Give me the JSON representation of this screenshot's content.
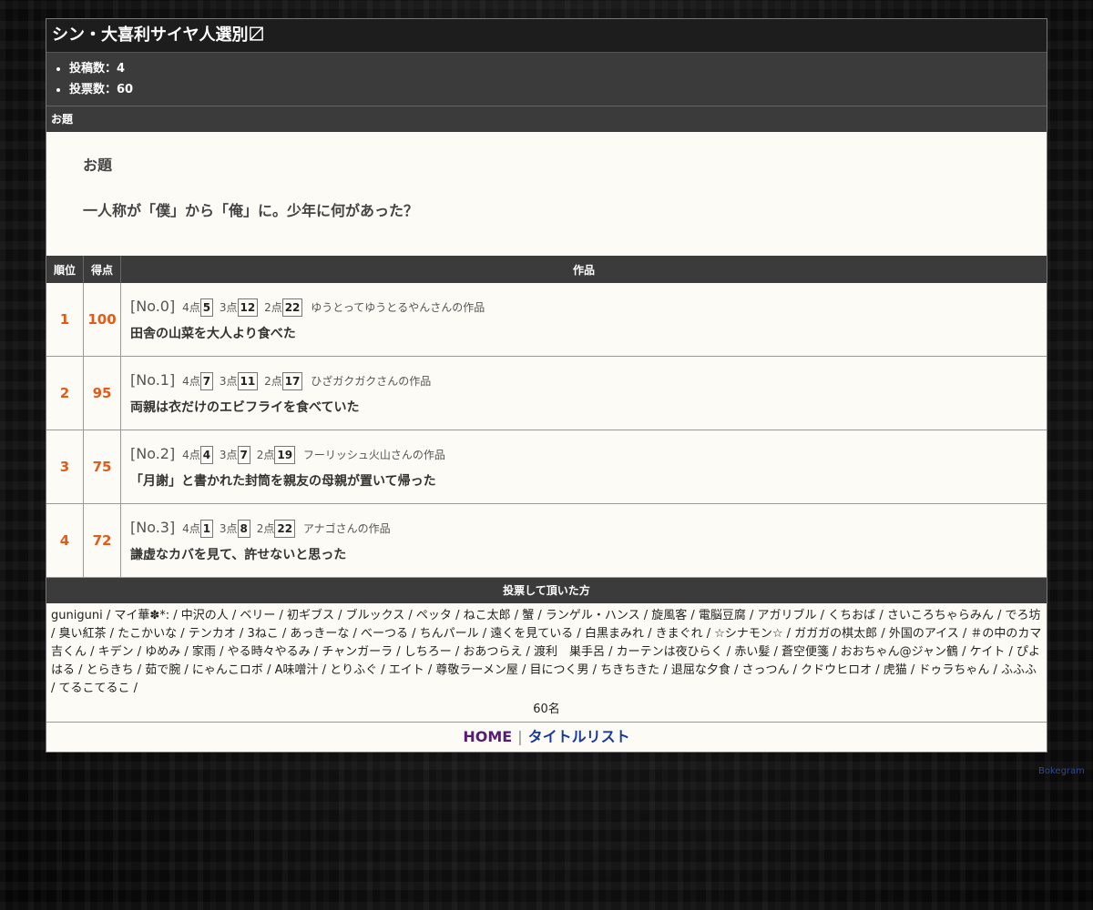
{
  "page": {
    "title": "シン・大喜利サイヤ人選別〼",
    "stats": [
      {
        "label": "投稿数：4"
      },
      {
        "label": "投票数：60"
      }
    ]
  },
  "theme": {
    "section_label": "お題",
    "label": "お題",
    "text": "一人称が「僕」から「俺」に。少年に何があった？"
  },
  "table": {
    "headers": {
      "rank": "順位",
      "score": "得点",
      "work": "作品"
    },
    "rows": [
      {
        "rank": "1",
        "score": "100",
        "no": "[No.0]",
        "p4_label": "4点",
        "p4": "5",
        "p3_label": "3点",
        "p3": "12",
        "p2_label": "2点",
        "p2": "22",
        "author": "ゆうとってゆうとるやんさんの作品",
        "title": "田舎の山菜を大人より食べた"
      },
      {
        "rank": "2",
        "score": "95",
        "no": "[No.1]",
        "p4_label": "4点",
        "p4": "7",
        "p3_label": "3点",
        "p3": "11",
        "p2_label": "2点",
        "p2": "17",
        "author": "ひざガクガクさんの作品",
        "title": "両親は衣だけのエビフライを食べていた"
      },
      {
        "rank": "3",
        "score": "75",
        "no": "[No.2]",
        "p4_label": "4点",
        "p4": "4",
        "p3_label": "3点",
        "p3": "7",
        "p2_label": "2点",
        "p2": "19",
        "author": "フーリッシュ火山さんの作品",
        "title": "「月謝」と書かれた封筒を親友の母親が置いて帰った"
      },
      {
        "rank": "4",
        "score": "72",
        "no": "[No.3]",
        "p4_label": "4点",
        "p4": "1",
        "p3_label": "3点",
        "p3": "8",
        "p2_label": "2点",
        "p2": "22",
        "author": "アナゴさんの作品",
        "title": "謙虚なカバを見て、許せないと思った"
      }
    ]
  },
  "voters": {
    "heading": "投票して頂いた方",
    "list": "guniguni / マイ華✽*: / 中沢の人 / ベリー / 初ギブス / ブルックス / ペッタ / ねこ太郎 / 蟹 / ランゲル・ハンス / 旋風客 / 電脳豆腐 / アガリブル / くちおば / さいころちゃらみん / でろ坊 / 臭い紅茶 / たこかいな / テンカオ / 3ねこ / あっきーな / べーつる / ちんパール / 遠くを見ている / 白黒まみれ / きまぐれ / ☆シナモン☆ / ガガガの棋太郎 / 外国のアイス / ＃の中のカマ吉くん / キデン / ゆめみ / 家雨 / やる時々やるみ / チャンガーラ / しちろー / おあつらえ / 渡利　巣手呂 / カーテンは夜ひらく / 赤い髪 / 蒼空便箋 / おおちゃん@ジャン鶴 / ケイト / ぴよはる / とらきち / 茹で腕 / にゃんこロボ / A味噌汁 / とりふぐ / エイト / 尊敬ラーメン屋 / 目につく男 / ちきちきた / 退屈な夕食 / さっつん / クドウヒロオ / 虎猫 / ドゥラちゃん / ふふふ / てるこてるこ /",
    "count": "60名"
  },
  "footer": {
    "home": "HOME",
    "separator": "|",
    "title_list": "タイトルリスト",
    "credit": "Bokegram"
  },
  "colors": {
    "accent_score": "#e25b1a",
    "home_link": "#5a1a7a",
    "list_link": "#1a3a9a",
    "header_bg": "#3b3b3b"
  }
}
